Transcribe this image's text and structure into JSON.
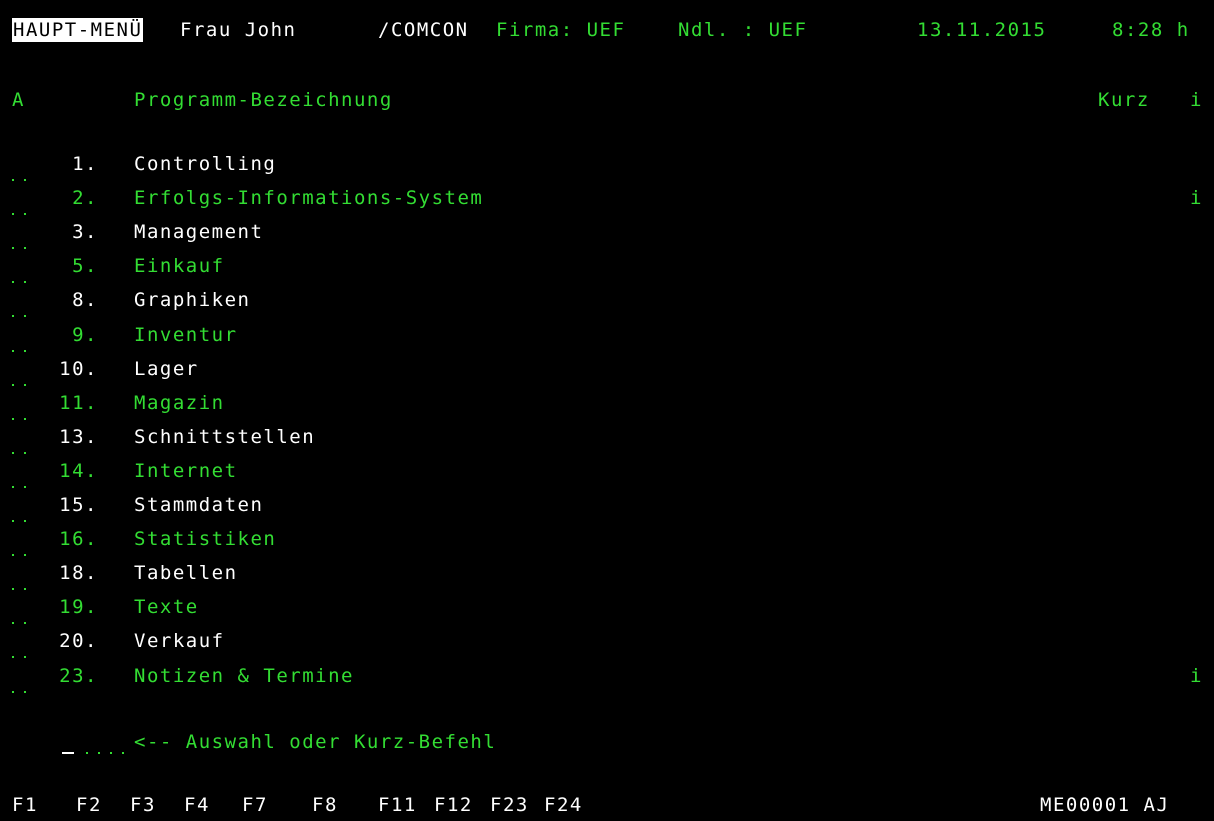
{
  "header": {
    "screen_title": "HAUPT-MENÜ",
    "user": "Frau John",
    "system": "/COMCON",
    "firma_label": "Firma: UEF",
    "ndl_label": "Ndl. : UEF",
    "date": "13.11.2015",
    "time": "8:28 h"
  },
  "columns": {
    "a": "A",
    "program": "Programm-Bezeichnung",
    "kurz": "Kurz",
    "info": "i"
  },
  "menu_items": [
    {
      "number": "1.",
      "label": "Controlling",
      "info": "",
      "color": "#ffffff"
    },
    {
      "number": "2.",
      "label": "Erfolgs-Informations-System",
      "info": "i",
      "color": "#33dd33"
    },
    {
      "number": "3.",
      "label": "Management",
      "info": "",
      "color": "#ffffff"
    },
    {
      "number": "5.",
      "label": "Einkauf",
      "info": "",
      "color": "#33dd33"
    },
    {
      "number": "8.",
      "label": "Graphiken",
      "info": "",
      "color": "#ffffff"
    },
    {
      "number": "9.",
      "label": "Inventur",
      "info": "",
      "color": "#33dd33"
    },
    {
      "number": "10.",
      "label": "Lager",
      "info": "",
      "color": "#ffffff"
    },
    {
      "number": "11.",
      "label": "Magazin",
      "info": "",
      "color": "#33dd33"
    },
    {
      "number": "13.",
      "label": "Schnittstellen",
      "info": "",
      "color": "#ffffff"
    },
    {
      "number": "14.",
      "label": "Internet",
      "info": "",
      "color": "#33dd33"
    },
    {
      "number": "15.",
      "label": "Stammdaten",
      "info": "",
      "color": "#ffffff"
    },
    {
      "number": "16.",
      "label": "Statistiken",
      "info": "",
      "color": "#33dd33"
    },
    {
      "number": "18.",
      "label": "Tabellen",
      "info": "",
      "color": "#ffffff"
    },
    {
      "number": "19.",
      "label": "Texte",
      "info": "",
      "color": "#33dd33"
    },
    {
      "number": "20.",
      "label": "Verkauf",
      "info": "",
      "color": "#ffffff"
    },
    {
      "number": "23.",
      "label": "Notizen & Termine",
      "info": "i",
      "color": "#33dd33"
    }
  ],
  "prompt": {
    "input_value": "",
    "hint": "<-- Auswahl oder Kurz-Befehl"
  },
  "function_keys": [
    "F1",
    "F2",
    "F3",
    "F4",
    "F7",
    "F8",
    "F11",
    "F12",
    "F23",
    "F24"
  ],
  "screen_id": "ME00001 AJ"
}
